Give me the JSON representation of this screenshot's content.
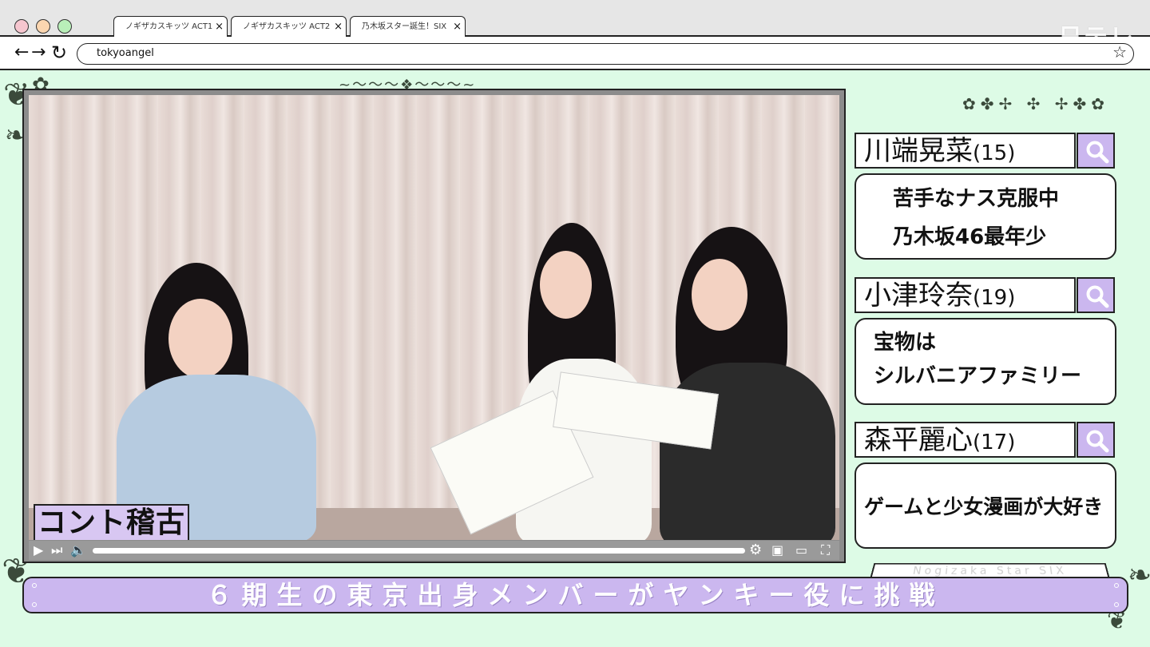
{
  "browser": {
    "tabs": [
      {
        "label": "ノギザカスキッツ ACT1"
      },
      {
        "label": "ノギザカスキッツ ACT2"
      },
      {
        "label": "乃木坂スター誕生！SIX"
      }
    ],
    "close_glyph": "×",
    "url": "tokyoangel",
    "watermark": "日テレ",
    "icons": {
      "back": "arrow-left-icon",
      "forward": "arrow-right-icon",
      "reload": "reload-icon",
      "bookmark": "star-icon"
    }
  },
  "video": {
    "caption": "コント稽古",
    "progress_fraction": 1.0,
    "icons": [
      "play-icon",
      "skip-next-icon",
      "volume-icon",
      "settings-icon",
      "miniplayer-icon",
      "theater-icon",
      "fullscreen-icon"
    ]
  },
  "profiles": [
    {
      "name": "川端晃菜",
      "age": "(15)",
      "lines": [
        "苦手なナス克服中",
        "乃木坂46最年少"
      ]
    },
    {
      "name": "小津玲奈",
      "age": "(19)",
      "lines": [
        "宝物は",
        "シルバニアファミリー"
      ]
    },
    {
      "name": "森平麗心",
      "age": "(17)",
      "lines": [
        "ゲームと少女漫画が大好き"
      ]
    }
  ],
  "footer": {
    "tagline": "Nogizaka Star SIX",
    "banner": "６期生の東京出身メンバーがヤンキー役に挑戦"
  },
  "colors": {
    "background": "#ddfbe6",
    "accent_lavender": "#cbb7ef",
    "caption_lavender": "#d8c7f2",
    "outline": "#222222"
  }
}
